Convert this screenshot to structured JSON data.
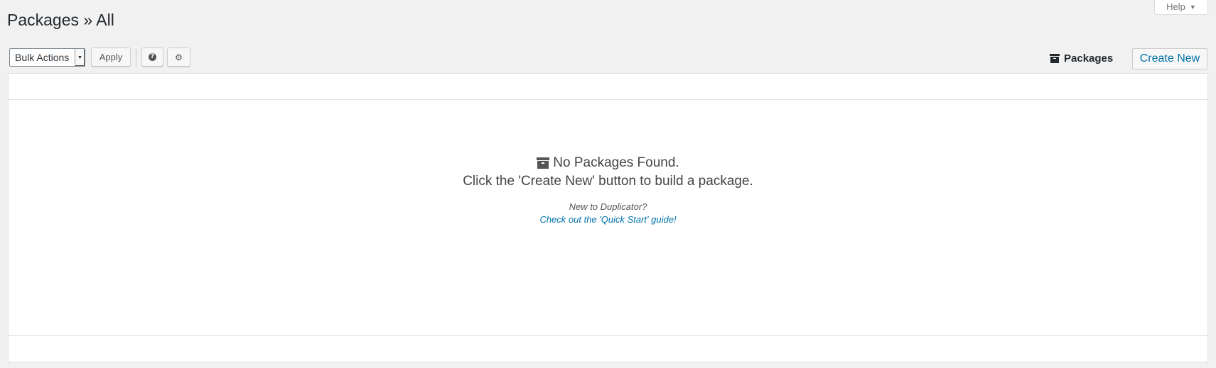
{
  "help_tab": {
    "label": "Help",
    "caret": "▼"
  },
  "page_title": "Packages » All",
  "toolbar": {
    "bulk_actions": "Bulk Actions",
    "apply_label": "Apply",
    "help_glyph": "?",
    "settings_glyph": "⚙",
    "icons": [
      "question-circle-icon",
      "gear-icon"
    ]
  },
  "header_right": {
    "packages_label": "Packages",
    "create_new_label": "Create New"
  },
  "empty_state": {
    "title": "No Packages Found.",
    "message": "Click the 'Create New' button to build a package.",
    "new_to": "New to Duplicator?",
    "quick_start_link": "Check out the 'Quick Start' guide!"
  },
  "colors": {
    "background": "#f1f1f1",
    "link": "#0073aa",
    "text": "#23282d"
  }
}
